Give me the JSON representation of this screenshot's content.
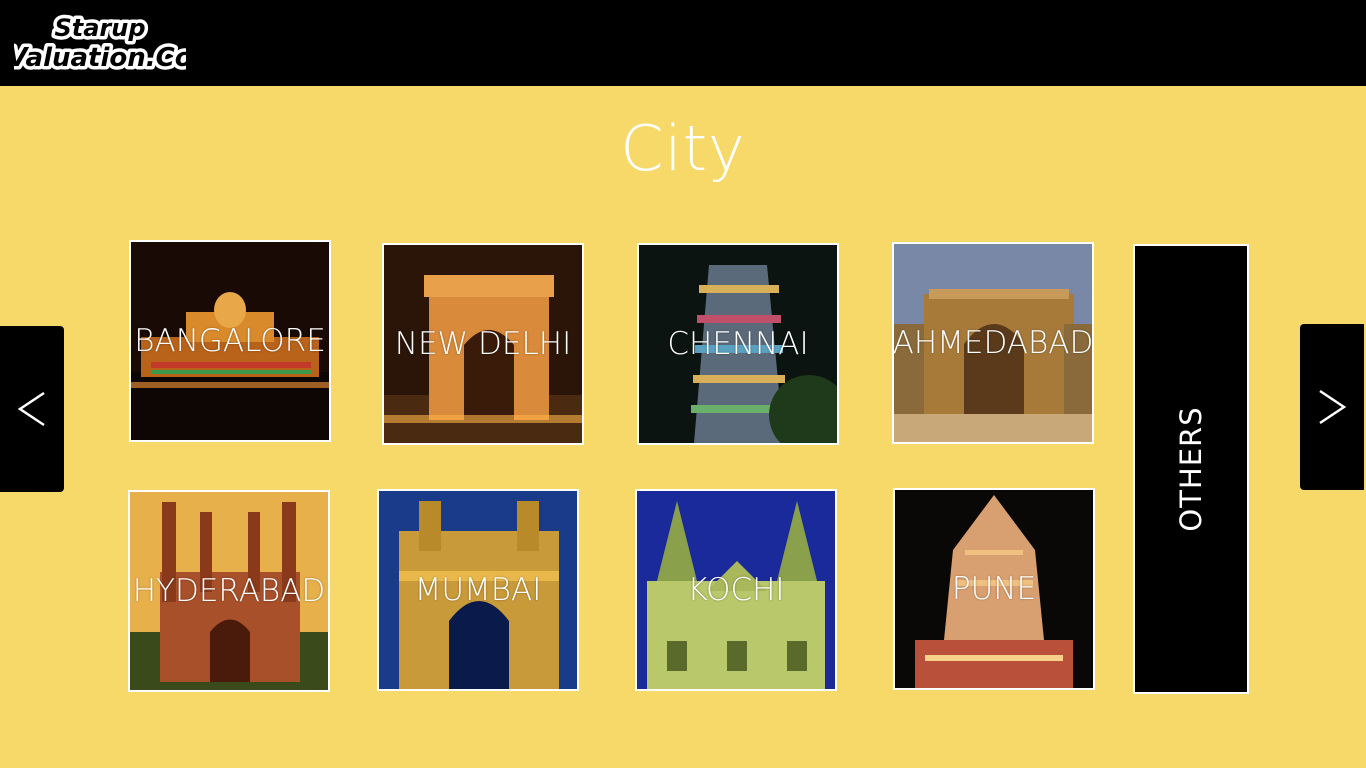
{
  "header": {
    "logo_line1": "Starup",
    "logo_line2": "Valuation.Co"
  },
  "page": {
    "title": "City"
  },
  "navigation": {
    "prev_icon": "chevron-left-icon",
    "next_icon": "chevron-right-icon"
  },
  "cities": [
    {
      "label": "BANGALORE"
    },
    {
      "label": "NEW DELHI"
    },
    {
      "label": "CHENNAI"
    },
    {
      "label": "AHMEDABAD"
    },
    {
      "label": "HYDERABAD"
    },
    {
      "label": "MUMBAI"
    },
    {
      "label": "KOCHI"
    },
    {
      "label": "PUNE"
    }
  ],
  "others": {
    "label": "OTHERS"
  },
  "colors": {
    "background": "#f6d968",
    "header": "#000000",
    "text": "#ffffff"
  }
}
